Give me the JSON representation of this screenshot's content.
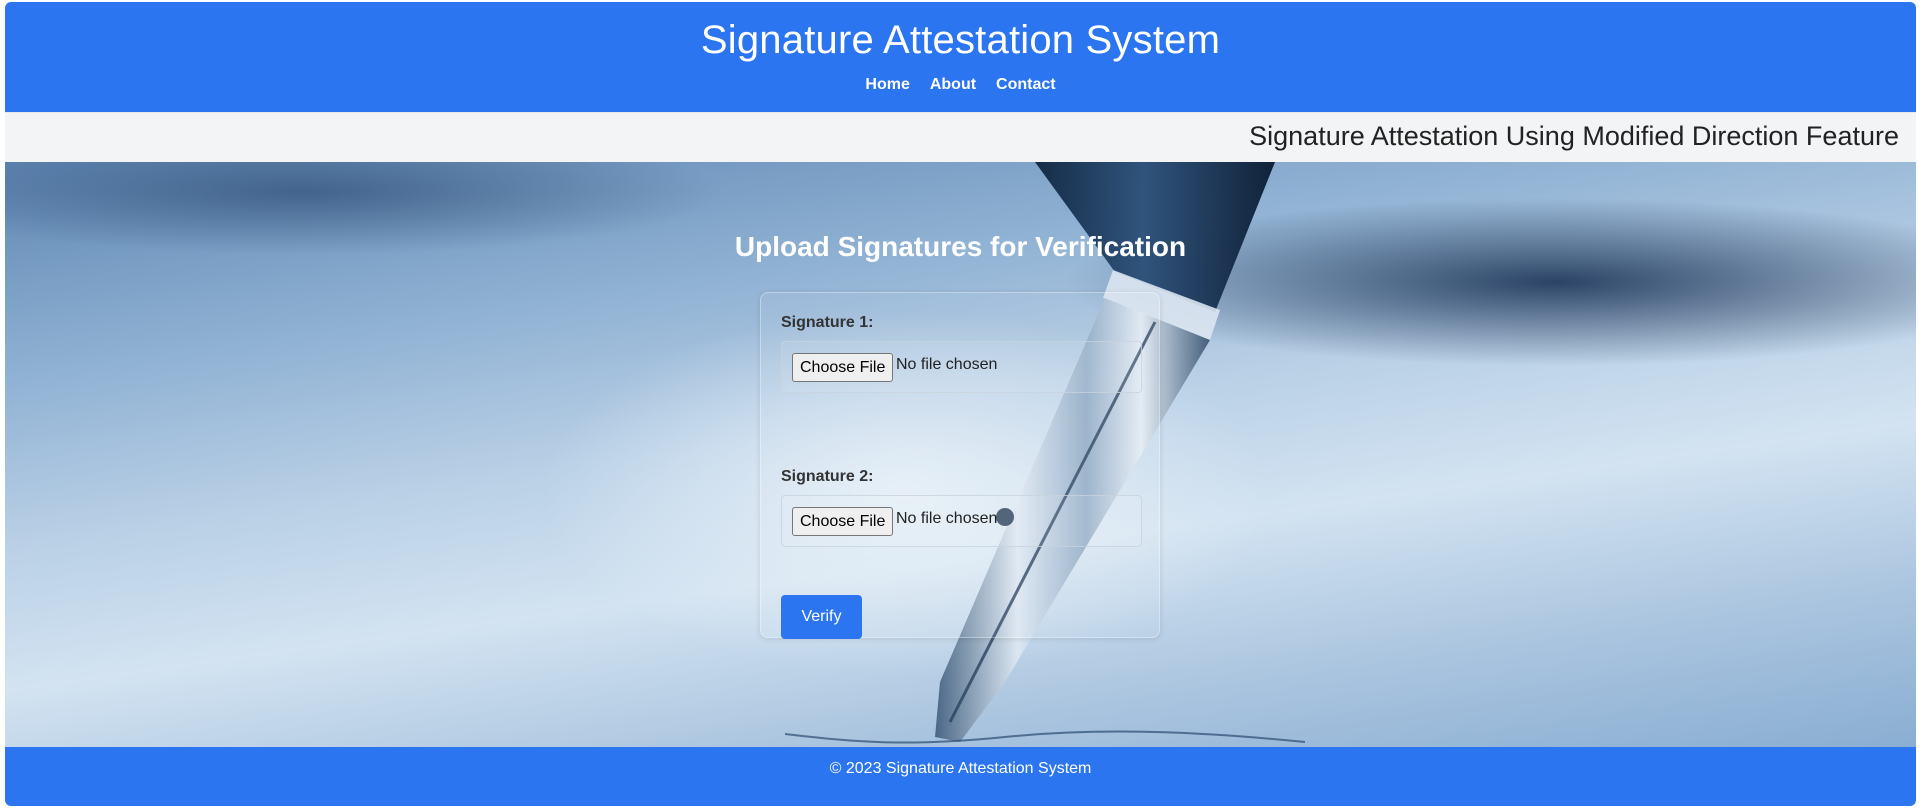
{
  "header": {
    "title": "Signature Attestation System",
    "nav": [
      "Home",
      "About",
      "Contact"
    ]
  },
  "subheader": {
    "text": "Signature Attestation Using Modified Direction Feature"
  },
  "main": {
    "title": "Upload Signatures for Verification",
    "fields": [
      {
        "label": "Signature 1:",
        "button": "Choose File",
        "status": "No file chosen"
      },
      {
        "label": "Signature 2:",
        "button": "Choose File",
        "status": "No file chosen"
      }
    ],
    "submit_label": "Verify"
  },
  "footer": {
    "text": "© 2023 Signature Attestation System"
  },
  "colors": {
    "primary": "#2b75f0",
    "subbar": "#f3f4f6"
  },
  "hero_image": "fountain-pen-nib"
}
